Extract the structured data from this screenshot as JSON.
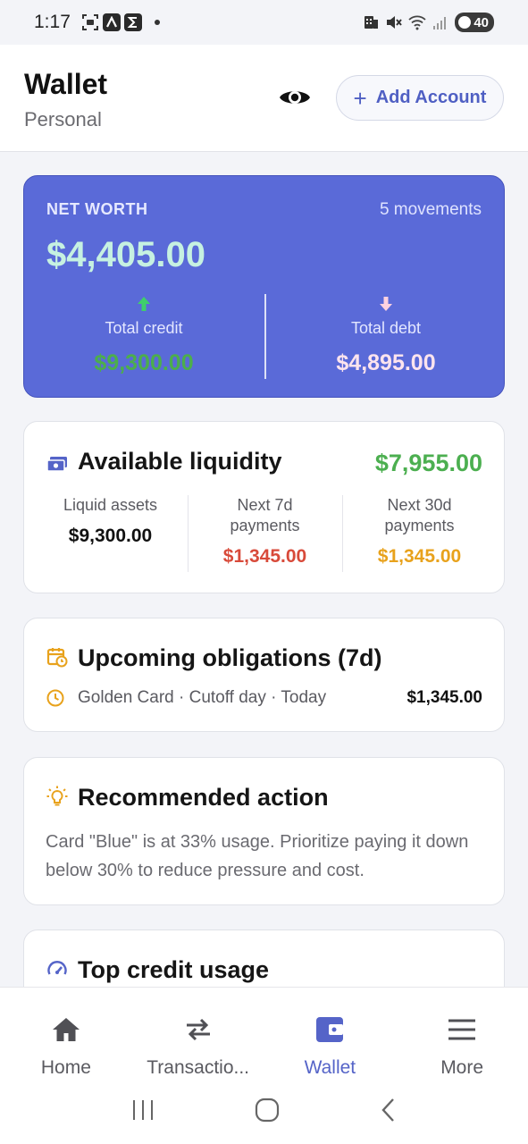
{
  "status_bar": {
    "time": "1:17",
    "battery": "40",
    "left_icons": [
      "screenshot-icon",
      "a-icon",
      "sigma-icon"
    ],
    "right_icons": [
      "nfc-icon",
      "mute-icon",
      "wifi-icon",
      "signal-icon"
    ]
  },
  "header": {
    "title": "Wallet",
    "subtitle": "Personal",
    "add_account_label": "Add Account"
  },
  "net_worth": {
    "label": "NET WORTH",
    "movements": "5 movements",
    "amount": "$4,405.00",
    "credit_label": "Total credit",
    "credit_value": "$9,300.00",
    "debt_label": "Total debt",
    "debt_value": "$4,895.00"
  },
  "liquidity": {
    "title": "Available liquidity",
    "amount": "$7,955.00",
    "columns": [
      {
        "label": "Liquid assets",
        "value": "$9,300.00",
        "color": "#111111"
      },
      {
        "label": "Next 7d payments",
        "value": "$1,345.00",
        "color": "#d84a3a"
      },
      {
        "label": "Next 30d payments",
        "value": "$1,345.00",
        "color": "#e8a21c"
      }
    ]
  },
  "obligations": {
    "title": "Upcoming obligations (7d)",
    "item_text": "Golden Card · Cutoff day · Today",
    "item_amount": "$1,345.00"
  },
  "recommendation": {
    "title": "Recommended action",
    "body": "Card \"Blue\" is at 33% usage. Prioritize paying it down below 30% to reduce pressure and cost."
  },
  "top_credit": {
    "title": "Top credit usage"
  },
  "bottom_nav": {
    "items": [
      {
        "label": "Home",
        "icon": "home-icon"
      },
      {
        "label": "Transactio...",
        "icon": "swap-icon"
      },
      {
        "label": "Wallet",
        "icon": "wallet-icon"
      },
      {
        "label": "More",
        "icon": "menu-icon"
      }
    ],
    "active": "Wallet"
  },
  "colors": {
    "accent": "#5564c8",
    "net_card": "#5a6ad8",
    "positive": "#4caf50",
    "negative": "#d84a3a",
    "warning": "#e8a21c"
  }
}
